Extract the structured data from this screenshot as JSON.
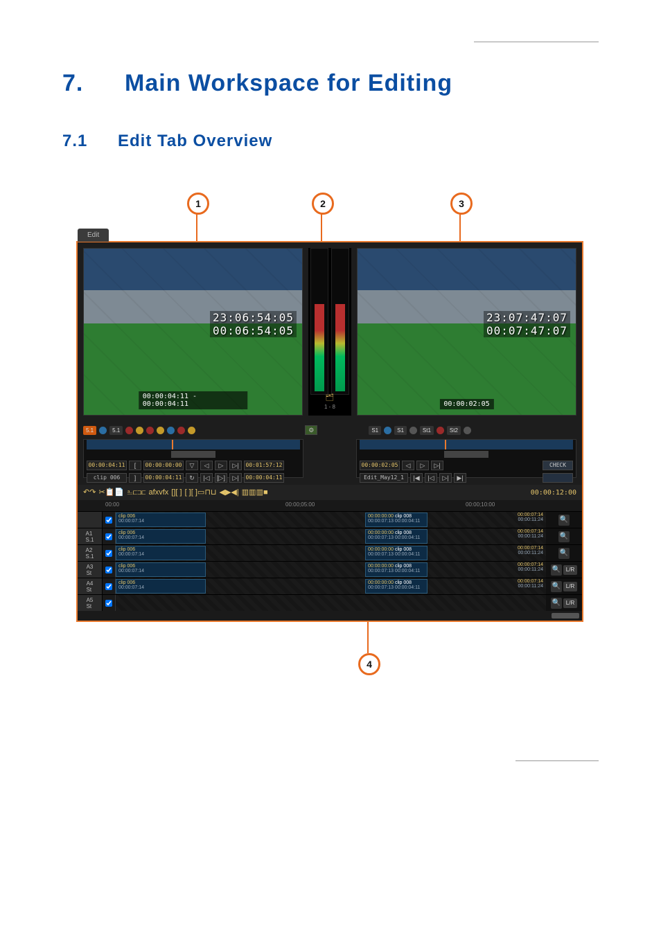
{
  "heading": {
    "num": "7.",
    "title": "Main Workspace for Editing"
  },
  "section": {
    "num": "7.1",
    "title": "Edit Tab Overview"
  },
  "callouts": [
    "1",
    "2",
    "3",
    "4"
  ],
  "tab_label": "Edit",
  "player_left": {
    "tc_main": "23:06:54:05",
    "tc_sub": "00:06:54:05",
    "range": "00:00:04:11  -  00:00:04:11"
  },
  "player_right": {
    "tc_main": "23:07:47:07",
    "tc_sub": "00:07:47:07",
    "pos": "00:00:02:05"
  },
  "meters": {
    "range": "1 - 8"
  },
  "audio_btns_left": [
    {
      "label": "5.1",
      "kind": "pill",
      "color": "#d05a10"
    },
    {
      "kind": "dot",
      "color": "#2b6ea3"
    },
    {
      "label": "5.1",
      "kind": "pill",
      "color": "#333"
    },
    {
      "kind": "dot",
      "color": "#9a2a2a"
    },
    {
      "kind": "dot",
      "color": "#c49a2a"
    },
    {
      "kind": "dot",
      "color": "#9a2a2a"
    },
    {
      "kind": "dot",
      "color": "#c49a2a"
    },
    {
      "kind": "dot",
      "color": "#2b6ea3"
    },
    {
      "kind": "dot",
      "color": "#9a2a2a"
    },
    {
      "kind": "dot",
      "color": "#c49a2a"
    }
  ],
  "audio_btns_right": [
    {
      "label": "S1",
      "kind": "pill",
      "color": "#333"
    },
    {
      "kind": "dot",
      "color": "#2b6ea3"
    },
    {
      "label": "S1",
      "kind": "pill",
      "color": "#333"
    },
    {
      "kind": "dot",
      "color": "#555"
    },
    {
      "label": "St1",
      "kind": "pill",
      "color": "#333"
    },
    {
      "kind": "dot",
      "color": "#9a2a2a"
    },
    {
      "label": "St2",
      "kind": "pill",
      "color": "#333"
    },
    {
      "kind": "dot",
      "color": "#555"
    }
  ],
  "panel_left": {
    "tc1": "00:00:04:11",
    "tc2": "00:00:00:00",
    "tc3": "00:01:57:12",
    "name": "clip 006",
    "tc4": "00:00:04:11",
    "tc5": "00:00:04:11"
  },
  "panel_right": {
    "tc1": "00:00:02:05",
    "name": "Edit_May12_1",
    "btn": "CHECK"
  },
  "toolbar_icons": [
    "↶",
    "↷",
    "✂",
    "📋",
    "📄",
    "⎁",
    "⊏⊐",
    "⊏",
    "afx",
    "vfx",
    "[",
    "]",
    "[ ]",
    "[ ]",
    "[ ]",
    "▭",
    "⊓⊔",
    "◀",
    "▶",
    "◀|",
    "▥",
    "▥",
    "▥",
    "■"
  ],
  "toolbar_tc": "00:00:12:00",
  "ruler": {
    "t0": "00:00",
    "t1": "00:00;05:00",
    "t2": "00:00;10:00"
  },
  "tracks": [
    {
      "hdr": "",
      "chk": true,
      "clipA": {
        "name": "clip 006",
        "tc": "00:00:07:14"
      },
      "clipB": {
        "name": "clip 008",
        "tc_in": "00:00:00:00",
        "tc_out": "00:00:04:11",
        "tc_top": "00:00:07:13"
      },
      "end": "00:00:07:14",
      "end2": "00:00:11:24",
      "zoom": true,
      "lr": false
    },
    {
      "hdr": "A1\nS.1",
      "chk": true,
      "clipA": {
        "name": "clip 006",
        "tc": "00:00:07:14"
      },
      "clipB": {
        "name": "clip 008",
        "tc_in": "00:00:00:00",
        "tc_out": "00:00:04:11",
        "tc_top": "00:00:07:13"
      },
      "end": "00:00:07:14",
      "end2": "00:00:11:24",
      "zoom": true,
      "lr": false
    },
    {
      "hdr": "A2\nS.1",
      "chk": true,
      "clipA": {
        "name": "clip 006",
        "tc": "00:00:07:14"
      },
      "clipB": {
        "name": "clip 008",
        "tc_in": "00:00:00:00",
        "tc_out": "00:00:04:11",
        "tc_top": "00:00:07:13"
      },
      "end": "00:00:07:14",
      "end2": "00:00:11:24",
      "zoom": true,
      "lr": false
    },
    {
      "hdr": "A3\nSt",
      "chk": true,
      "clipA": {
        "name": "clip 006",
        "tc": "00:00:07:14"
      },
      "clipB": {
        "name": "clip 008",
        "tc_in": "00:00:00:00",
        "tc_out": "00:00:04:11",
        "tc_top": "00:00:07:13"
      },
      "end": "00:00:07:14",
      "end2": "00:00:11:24",
      "zoom": true,
      "lr": true
    },
    {
      "hdr": "A4\nSt",
      "chk": true,
      "clipA": {
        "name": "clip 006",
        "tc": "00:00:07:14"
      },
      "clipB": {
        "name": "clip 008",
        "tc_in": "00:00:00:00",
        "tc_out": "00:00:04:11",
        "tc_top": "00:00:07:13"
      },
      "end": "00:00:07:14",
      "end2": "00:00:11:24",
      "zoom": true,
      "lr": true
    },
    {
      "hdr": "A5\nSt",
      "chk": true,
      "empty": true,
      "zoom": true,
      "lr": true
    }
  ]
}
